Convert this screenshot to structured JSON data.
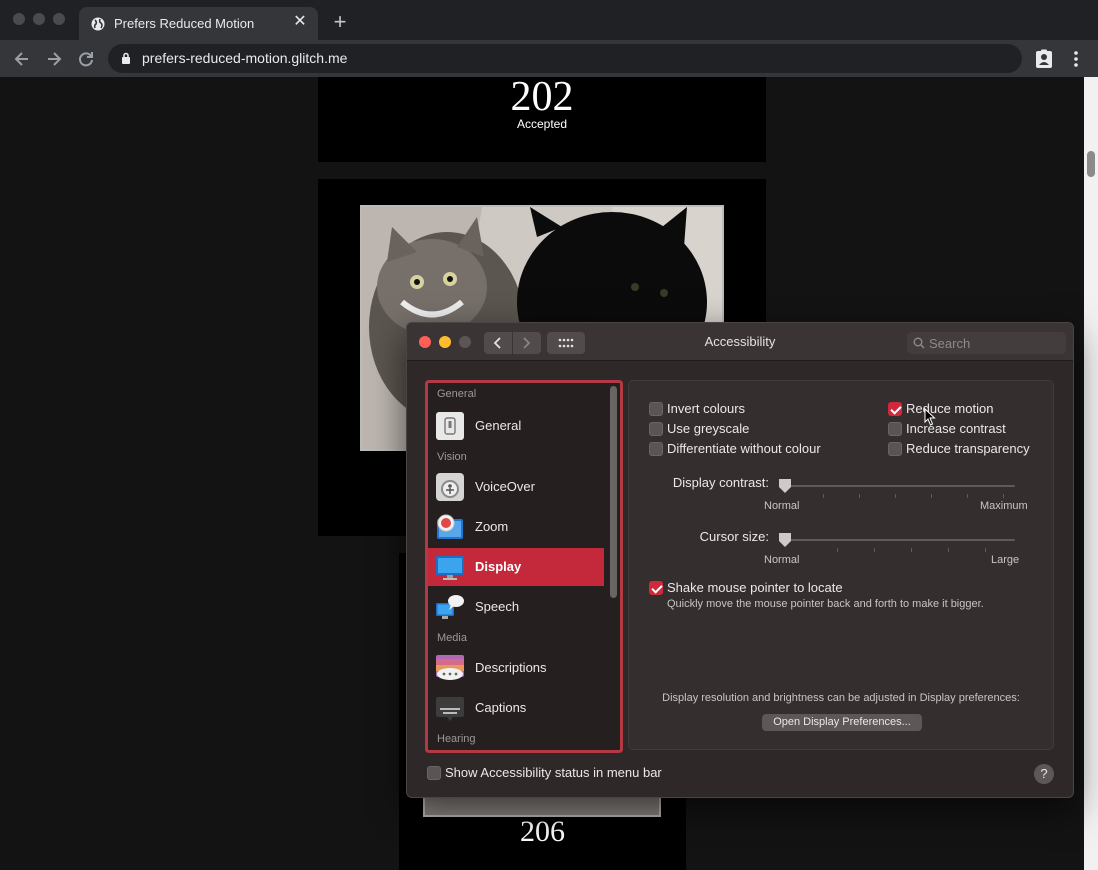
{
  "browser": {
    "tab_title": "Prefers Reduced Motion",
    "tab_close": "✕",
    "new_tab": "+",
    "url": "prefers-reduced-motion.glitch.me"
  },
  "content": {
    "card1": {
      "number": "202",
      "label": "Accepted"
    },
    "card3": {
      "number": "206"
    }
  },
  "accessibility": {
    "title": "Accessibility",
    "search_placeholder": "Search",
    "sidebar": {
      "sections": [
        "General",
        "Vision",
        "Media",
        "Hearing"
      ],
      "items": [
        {
          "label": "General",
          "icon": "general-icon"
        },
        {
          "label": "VoiceOver",
          "icon": "voiceover-icon"
        },
        {
          "label": "Zoom",
          "icon": "zoom-icon"
        },
        {
          "label": "Display",
          "icon": "display-icon",
          "selected": true
        },
        {
          "label": "Speech",
          "icon": "speech-icon"
        },
        {
          "label": "Descriptions",
          "icon": "descriptions-icon"
        },
        {
          "label": "Captions",
          "icon": "captions-icon"
        }
      ]
    },
    "options": {
      "invert_colours": {
        "label": "Invert colours",
        "checked": false
      },
      "use_greyscale": {
        "label": "Use greyscale",
        "checked": false
      },
      "differentiate": {
        "label": "Differentiate without colour",
        "checked": false
      },
      "reduce_motion": {
        "label": "Reduce motion",
        "checked": true
      },
      "increase_contrast": {
        "label": "Increase contrast",
        "checked": false
      },
      "reduce_transparency": {
        "label": "Reduce transparency",
        "checked": false
      }
    },
    "display_contrast": {
      "label": "Display contrast:",
      "min_label": "Normal",
      "max_label": "Maximum",
      "value": 0
    },
    "cursor_size": {
      "label": "Cursor size:",
      "min_label": "Normal",
      "max_label": "Large",
      "value": 0
    },
    "shake": {
      "label": "Shake mouse pointer to locate",
      "checked": true,
      "description": "Quickly move the mouse pointer back and forth to make it bigger."
    },
    "display_note": "Display resolution and brightness can be adjusted in Display preferences:",
    "open_display_button": "Open Display Preferences...",
    "menu_bar_status": {
      "label": "Show Accessibility status in menu bar",
      "checked": false
    },
    "help": "?"
  },
  "colors": {
    "accent": "#d2283b",
    "selection": "#c4293b",
    "window_bg": "#2e2829"
  }
}
